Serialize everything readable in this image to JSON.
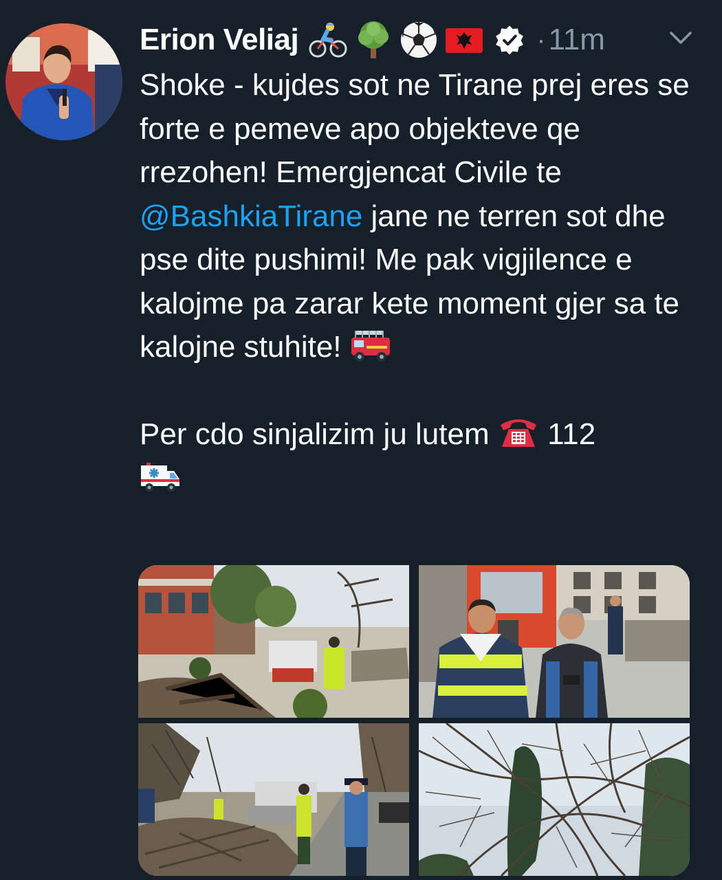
{
  "tweet": {
    "author_name": "Erion Veliaj",
    "name_emojis": [
      "cyclist-emoji",
      "tree-emoji",
      "soccer-ball-emoji",
      "albania-flag-emoji",
      "verified-badge-icon"
    ],
    "separator": "·",
    "timestamp": "11m",
    "text": {
      "part1": "Shoke - kujdes sot ne Tirane prej eres se forte e pemeve apo objekteve qe rrezohen! Emergjencat Civile te ",
      "mention": "@BashkiaTirane",
      "part2": " jane ne terren sot dhe pse dite pushimi! Me pak vigjilence e kalojme pa zarar kete moment gjer sa te kalojne stuhite! ",
      "line2_part1": "Per cdo sinjalizim ju lutem ",
      "line2_number": " 112"
    },
    "inline_emojis": [
      "fire-engine-emoji",
      "telephone-emoji",
      "ambulance-emoji"
    ],
    "photos": [
      {
        "name": "photo-fallen-tree-street"
      },
      {
        "name": "photo-emergency-workers-truck"
      },
      {
        "name": "photo-police-street-cleanup"
      },
      {
        "name": "photo-tree-branches-sky"
      }
    ]
  },
  "colors": {
    "background": "#15202b",
    "text": "#ffffff",
    "secondary_text": "#8899a6",
    "link": "#1da1f2"
  }
}
